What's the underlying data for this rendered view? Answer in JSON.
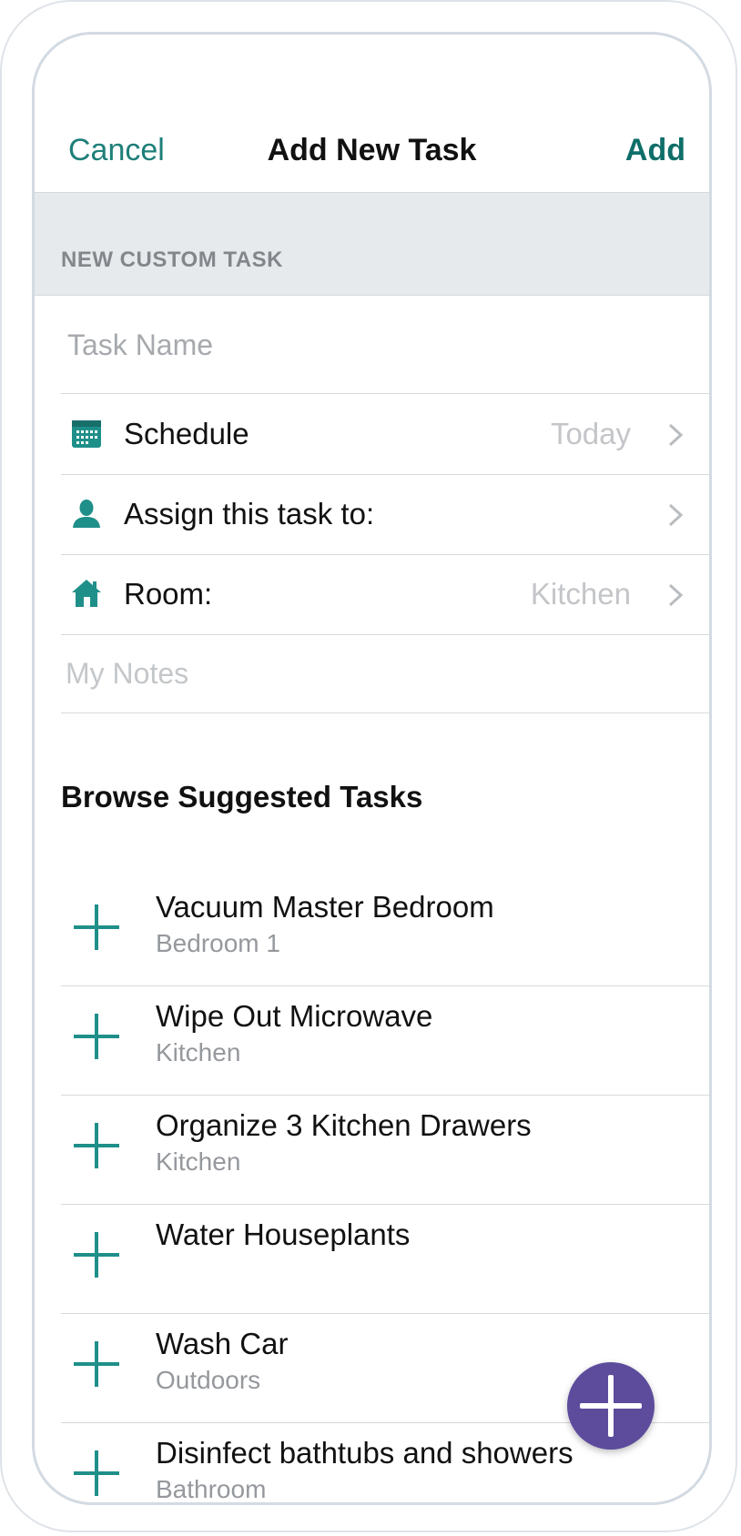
{
  "colors": {
    "accent": "#1f7f7a",
    "fab": "#5d4c9c"
  },
  "nav": {
    "cancel": "Cancel",
    "title": "Add New Task",
    "add": "Add"
  },
  "section": {
    "label": "NEW CUSTOM TASK"
  },
  "form": {
    "task_name_placeholder": "Task Name",
    "schedule": {
      "icon": "calendar-icon",
      "label": "Schedule",
      "value": "Today"
    },
    "assign": {
      "icon": "person-icon",
      "label": "Assign this task to:",
      "value": ""
    },
    "room": {
      "icon": "house-icon",
      "label": "Room:",
      "value": "Kitchen"
    },
    "notes_placeholder": "My Notes"
  },
  "browse": {
    "title": "Browse Suggested Tasks",
    "items": [
      {
        "title": "Vacuum Master Bedroom",
        "room": "Bedroom 1"
      },
      {
        "title": "Wipe Out Microwave",
        "room": "Kitchen"
      },
      {
        "title": "Organize 3 Kitchen Drawers",
        "room": "Kitchen"
      },
      {
        "title": "Water Houseplants",
        "room": ""
      },
      {
        "title": "Wash Car",
        "room": "Outdoors"
      },
      {
        "title": "Disinfect bathtubs and showers",
        "room": "Bathroom"
      }
    ]
  },
  "fab": {
    "icon": "plus-icon"
  }
}
